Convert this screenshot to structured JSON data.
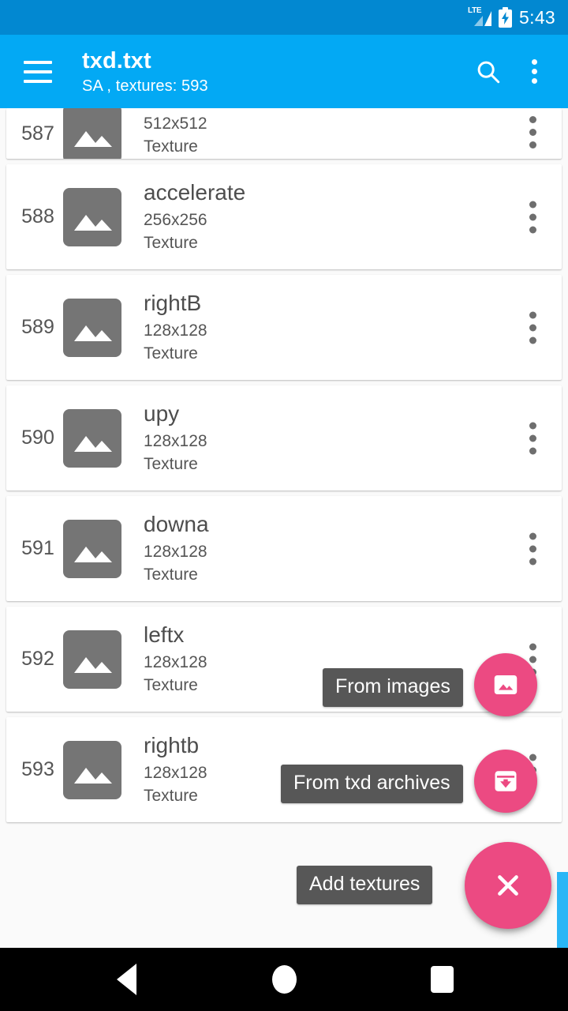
{
  "status_bar": {
    "network_label": "LTE",
    "network_icon": "signal-lte-icon",
    "battery_icon": "battery-charging-icon",
    "time": "5:43"
  },
  "app_bar": {
    "menu_icon": "hamburger-menu-icon",
    "title": "txd.txt",
    "subtitle": "SA , textures: 593",
    "search_icon": "search-icon",
    "overflow_icon": "more-vert-icon",
    "background_color": "#03a9f4"
  },
  "list": {
    "items": [
      {
        "index": "587",
        "name": "",
        "dimensions": "512x512",
        "type": "Texture",
        "partial": true
      },
      {
        "index": "588",
        "name": "accelerate",
        "dimensions": "256x256",
        "type": "Texture",
        "partial": false
      },
      {
        "index": "589",
        "name": "rightB",
        "dimensions": "128x128",
        "type": "Texture",
        "partial": false
      },
      {
        "index": "590",
        "name": "upy",
        "dimensions": "128x128",
        "type": "Texture",
        "partial": false
      },
      {
        "index": "591",
        "name": "downa",
        "dimensions": "128x128",
        "type": "Texture",
        "partial": false
      },
      {
        "index": "592",
        "name": "leftx",
        "dimensions": "128x128",
        "type": "Texture",
        "partial": false
      },
      {
        "index": "593",
        "name": "rightb",
        "dimensions": "128x128",
        "type": "Texture",
        "partial": false
      }
    ]
  },
  "fab_menu": {
    "accent_color": "#ec4a82",
    "label_background": "#575757",
    "from_images_label": "From images",
    "from_images_icon": "image-icon",
    "from_txd_label": "From txd archives",
    "from_txd_icon": "archive-download-icon",
    "main_label": "Add textures",
    "main_icon": "close-icon"
  },
  "scroll_indicator": {
    "color": "#29b6f6"
  },
  "nav_bar": {
    "back_icon": "triangle-back-icon",
    "home_icon": "circle-home-icon",
    "recents_icon": "square-recents-icon"
  }
}
